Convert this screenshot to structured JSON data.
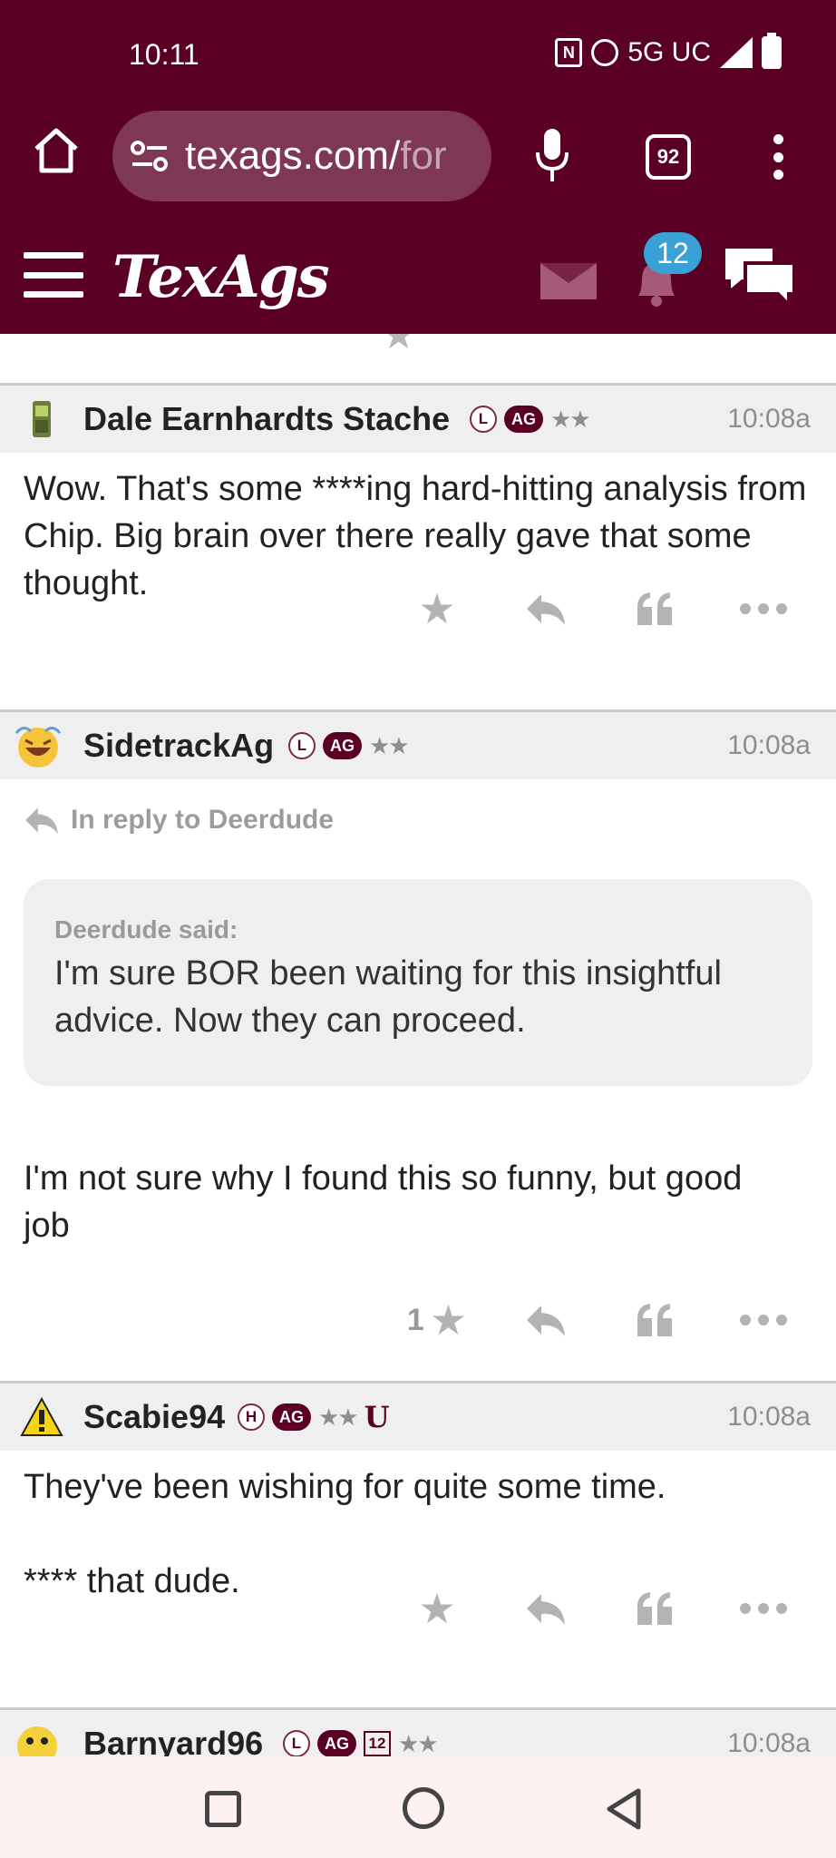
{
  "status_bar": {
    "time": "10:11",
    "network": "5G UC",
    "nfc_label": "N"
  },
  "browser": {
    "url_main": "texags.com/",
    "url_dim": "for",
    "tab_count": "92"
  },
  "site_header": {
    "logo": "TexAgs",
    "notification_count": "12"
  },
  "posts": [
    {
      "username": "Dale Earnhardts Stache",
      "badges": [
        "L",
        "AG"
      ],
      "stars": "★★",
      "time": "10:08a",
      "body": "Wow. That's some ****ing hard-hitting analysis from Chip. Big brain over there really gave that some thought.",
      "likes": ""
    },
    {
      "username": "SidetrackAg",
      "badges": [
        "L",
        "AG"
      ],
      "stars": "★★",
      "time": "10:08a",
      "reply_to": "In reply to Deerdude",
      "quote_author": "Deerdude said:",
      "quote_text": "I'm sure BOR been waiting for this insightful advice. Now they can proceed.",
      "body": "I'm not sure why I found this so funny, but good job",
      "likes": "1"
    },
    {
      "username": "Scabie94",
      "badges": [
        "H",
        "AG"
      ],
      "stars": "★★",
      "extra_badge": "U",
      "time": "10:08a",
      "body_line1": "They've been wishing for quite some time.",
      "body_line2": "**** that dude.",
      "likes": ""
    },
    {
      "username": "Barnyard96",
      "badges": [
        "L",
        "AG",
        "12"
      ],
      "stars": "★★",
      "time": "10:08a"
    }
  ],
  "action_icons": [
    "star-icon",
    "reply-icon",
    "quote-icon",
    "more-icon"
  ],
  "colors": {
    "maroon": "#5a0024",
    "badge_blue": "#3aa1d6",
    "action_gray": "#b3b3b3"
  }
}
